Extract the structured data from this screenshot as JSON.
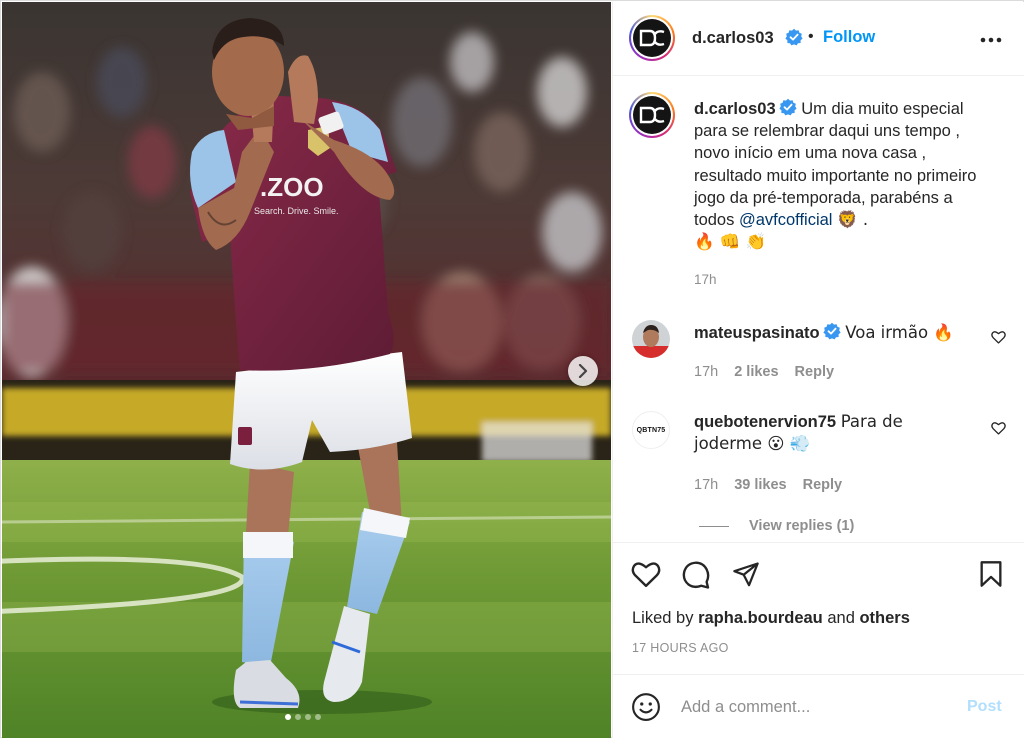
{
  "post": {
    "username": "d.carlos03",
    "separator": "•",
    "follow_label": "Follow",
    "photo": {
      "page_count": 4,
      "active_index": 0
    }
  },
  "caption": {
    "username": "d.carlos03",
    "text_before_mention": "Um dia muito especial para se relembrar daqui uns tempo , novo início em uma nova casa , resultado muito importante no primeiro jogo da pré-temporada, parabéns a todos",
    "mention": "@avfcofficial",
    "text_after_mention": "🦁 .",
    "emojis_line": "🔥 👊 👏",
    "time": "17h"
  },
  "comments": [
    {
      "username": "mateuspasinato",
      "text": "Voa irmão 🔥",
      "time": "17h",
      "likes": "2 likes",
      "reply_label": "Reply"
    },
    {
      "username": "quebotenervion75",
      "text": "Para de joderme 😮 💨",
      "time": "17h",
      "likes": "39 likes",
      "reply_label": "Reply",
      "avatar_text": "QBTN75"
    }
  ],
  "view_replies": "View replies (1)",
  "likes_line": {
    "prefix": "Liked by",
    "user": "rapha.bourdeau",
    "middle": "and",
    "others": "others"
  },
  "time_ago": "17 HOURS AGO",
  "add_comment": {
    "placeholder": "Add a comment...",
    "post_label": "Post"
  },
  "sponsor_text": ".ZOO",
  "sponsor_sub": "Search. Drive. Smile.",
  "icons": {
    "verified": "verified-badge-icon",
    "more": "more-options-icon",
    "like": "heart-icon",
    "comment": "comment-icon",
    "share": "share-icon",
    "save": "bookmark-icon",
    "emoji": "emoji-icon",
    "next": "chevron-right-icon"
  },
  "colors": {
    "link_blue": "#0095f6",
    "mention_blue": "#00376b",
    "post_disabled": "#b2dffc",
    "secondary_text": "#8e8e8e",
    "verified_blue": "#3897f0",
    "claret": "#7a1f3d",
    "sky_blue": "#95bfe5"
  }
}
